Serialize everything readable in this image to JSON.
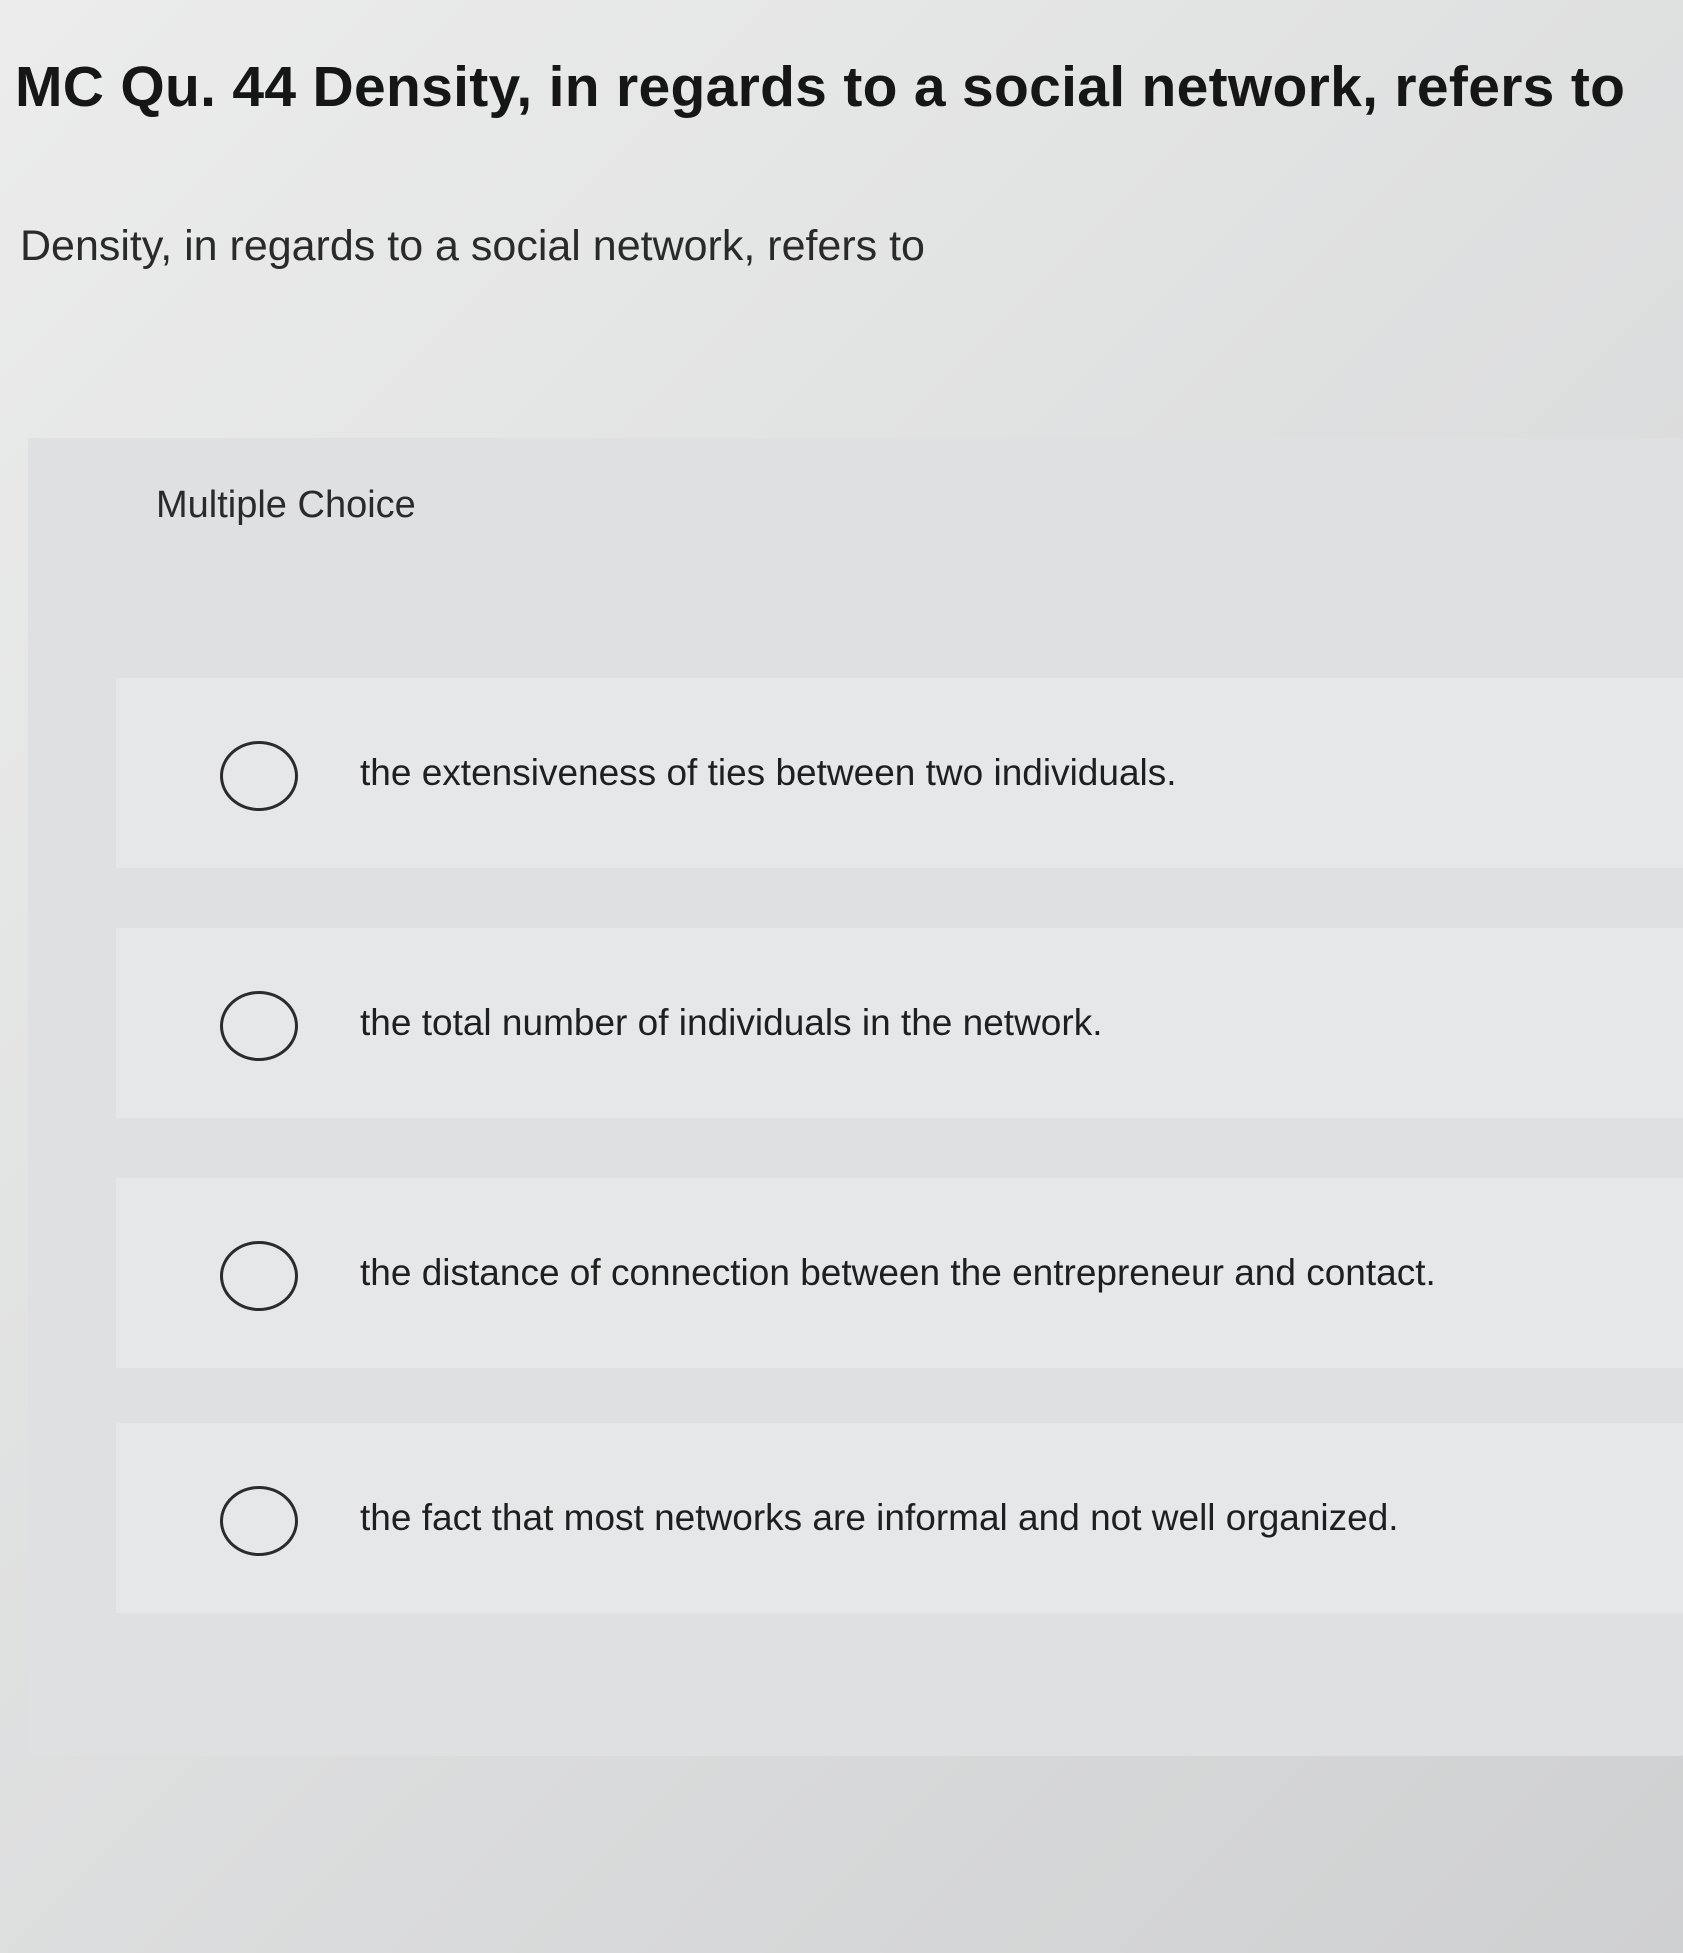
{
  "header": {
    "title": "MC Qu. 44 Density, in regards to a social network, refers to"
  },
  "question": {
    "prompt": "Density, in regards to a social network, refers to"
  },
  "choices": {
    "type_label": "Multiple Choice",
    "options": [
      {
        "label": "the extensiveness of ties between two individuals.",
        "selected": false
      },
      {
        "label": "the total number of individuals in the network.",
        "selected": false
      },
      {
        "label": "the distance of connection between the entrepreneur and contact.",
        "selected": false
      },
      {
        "label": "the fact that most networks are informal and not well organized.",
        "selected": false
      }
    ]
  }
}
